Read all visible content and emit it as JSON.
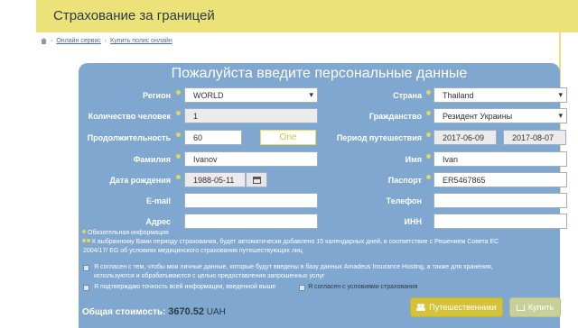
{
  "header": {
    "title": "Страхование за границей"
  },
  "breadcrumb": {
    "item1": "Онлайн сервис",
    "item2": "Купить полис онлайн"
  },
  "panel": {
    "title": "Пожалуйста введите персональные данные"
  },
  "labels": {
    "region": "Регион",
    "country": "Страна",
    "count": "Количество человек",
    "citizenship": "Гражданство",
    "duration": "Продолжительность",
    "period": "Период путешествия",
    "surname": "Фамилия",
    "name": "Имя",
    "birthdate": "Дата рождения",
    "passport": "Паспорт",
    "email": "E-mail",
    "phone": "Телефон",
    "address": "Адрес",
    "inn": "ИНН"
  },
  "values": {
    "region": "WORLD",
    "country": "Thailand",
    "count": "1",
    "citizenship": "Резидент Украины",
    "duration": "60",
    "duration_unit": "One",
    "period_from": "2017-06-09",
    "period_to": "2017-08-07",
    "surname": "Ivanov",
    "name": "Ivan",
    "birthdate": "1988-05-11",
    "passport": "ER5467865",
    "email": "",
    "phone": "",
    "address": "",
    "inn": ""
  },
  "notes": {
    "required": "Обязательная информация",
    "extra_line1": "К выбранному Вами периоду страхования, будет автоматически добавлено 15 календарных дней, в соответствие с Решением Совета ЕС",
    "extra_line2": "2004/17/ EG об условиях медицинского страхования путешествующих лиц",
    "consent_line1": "Я согласен с тем, чтобы мои личные данные, которые будут введены в базу данных Amadeus Insurance Hosting, а также для хранения,",
    "consent_line2": "используются и обрабатываются с целью предоставления запрошенных услуг",
    "confirm": "Я подтверждаю точность всей информации, введенной выше",
    "conditions_link": "Я согласен с условиями страхования"
  },
  "total": {
    "label": "Общая стоимость:",
    "value": "3670.52",
    "currency": "UAH"
  },
  "buttons": {
    "travelers": "Путешественники",
    "buy": "Купить"
  },
  "colors": {
    "panel": "#7fa7cf",
    "accent": "#ebe37a",
    "button": "#d4c339"
  }
}
